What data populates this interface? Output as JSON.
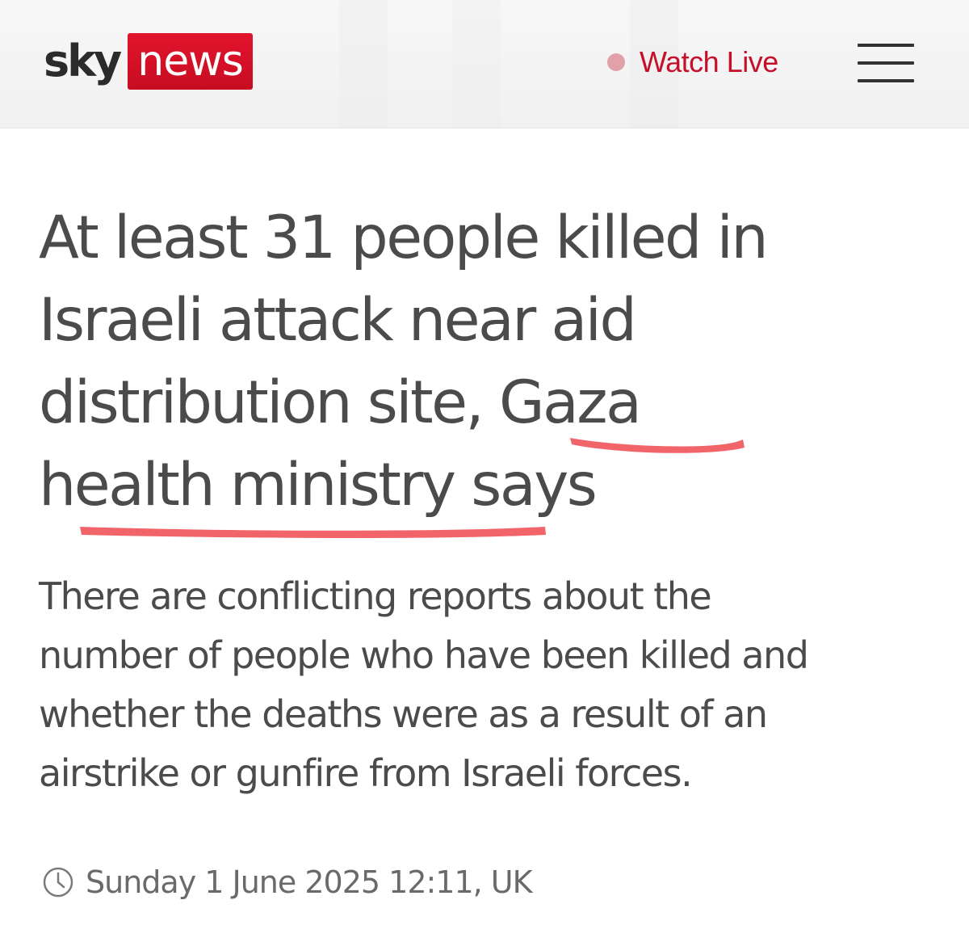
{
  "header": {
    "logo_sky": "sky",
    "logo_news": "news",
    "watch_live_label": "Watch Live",
    "menu_icon": "hamburger-menu-icon",
    "live_icon": "live-dot-icon",
    "brand_color": "#c70d22"
  },
  "article": {
    "headline_lines": [
      "At least 31 people killed in",
      "Israeli attack near aid",
      "distribution site, Gaza",
      "health ministry says"
    ],
    "standfirst_lines": [
      "There are conflicting reports about the",
      "number of people who have been killed and",
      "whether the deaths were as a result of an",
      "airstrike or gunfire from Israeli forces."
    ],
    "timestamp": "Sunday 1 June 2025 12:11, UK",
    "timestamp_icon": "clock-icon",
    "annotation_color": "#f0545a"
  }
}
